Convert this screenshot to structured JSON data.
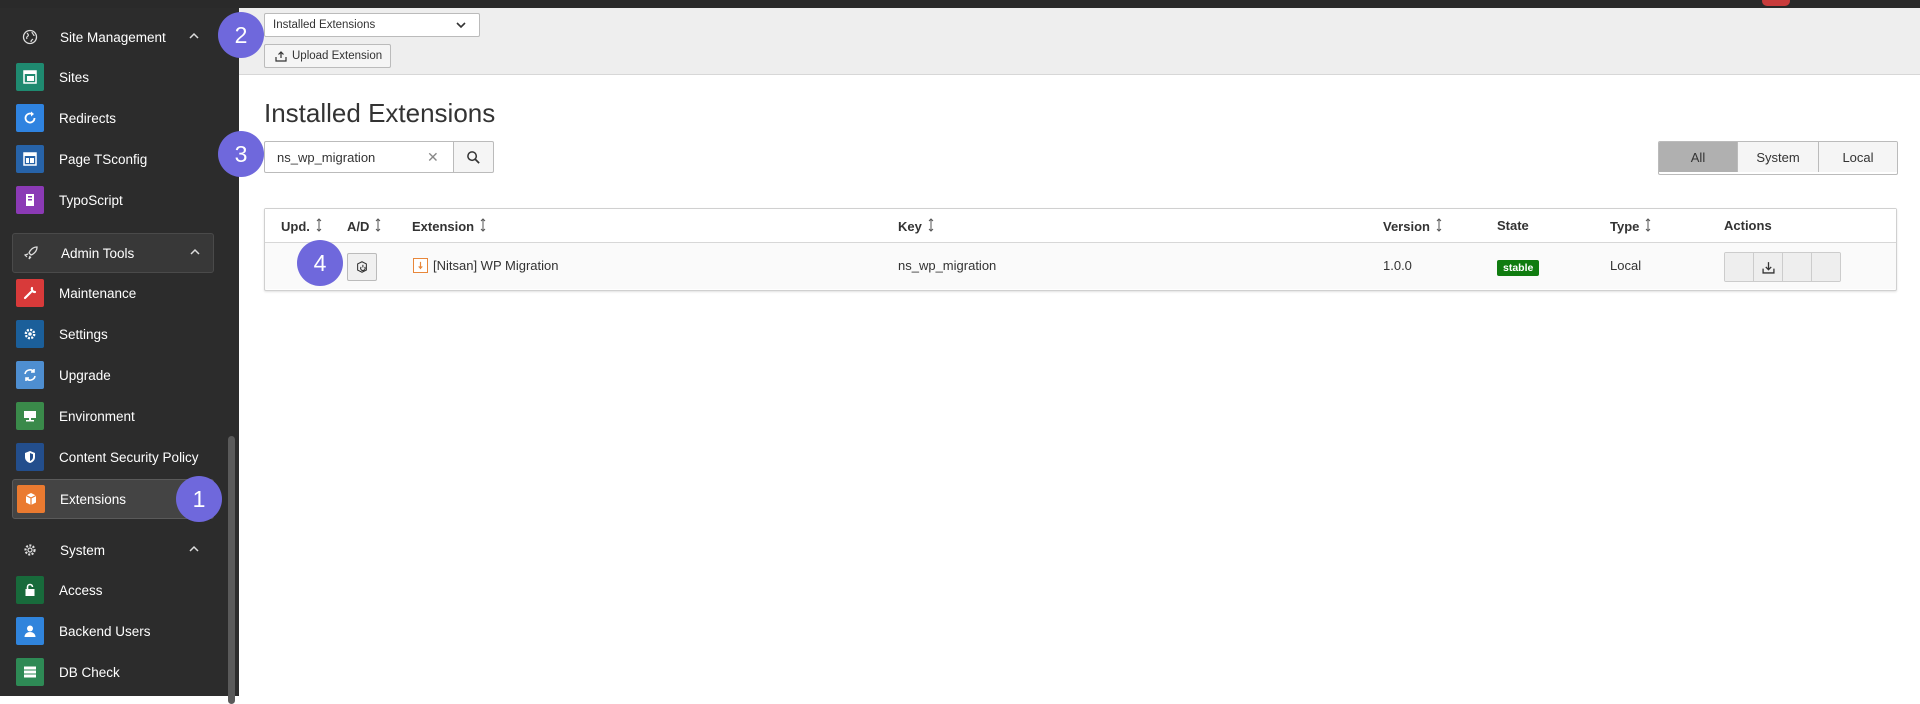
{
  "sidebar": {
    "groups": [
      {
        "label": "Site Management",
        "icon": "globe-icon"
      },
      {
        "label": "Admin Tools",
        "icon": "rocket-icon"
      },
      {
        "label": "System",
        "icon": "gear-icon"
      }
    ],
    "items": [
      {
        "label": "Sites",
        "color": "#1f8a70",
        "icon": "sites-icon"
      },
      {
        "label": "Redirects",
        "color": "#2f83e0",
        "icon": "redirect-icon"
      },
      {
        "label": "Page TSconfig",
        "color": "#2763a8",
        "icon": "tsconfig-icon"
      },
      {
        "label": "TypoScript",
        "color": "#8b3ab5",
        "icon": "typoscript-icon"
      },
      {
        "label": "Maintenance",
        "color": "#d83a3a",
        "icon": "wrench-icon"
      },
      {
        "label": "Settings",
        "color": "#1b5f9a",
        "icon": "cog-icon"
      },
      {
        "label": "Upgrade",
        "color": "#4e8ed0",
        "icon": "refresh-icon"
      },
      {
        "label": "Environment",
        "color": "#3a8a4a",
        "icon": "monitor-icon"
      },
      {
        "label": "Content Security Policy",
        "color": "#234e8c",
        "icon": "shield-icon"
      },
      {
        "label": "Extensions",
        "color": "#ea7a30",
        "icon": "box-icon"
      },
      {
        "label": "Access",
        "color": "#186a3b",
        "icon": "lock-icon"
      },
      {
        "label": "Backend Users",
        "color": "#3084dc",
        "icon": "user-icon"
      },
      {
        "label": "DB Check",
        "color": "#2e8a55",
        "icon": "database-icon"
      }
    ]
  },
  "header": {
    "select_value": "Installed Extensions",
    "upload_label": "Upload Extension"
  },
  "main": {
    "title": "Installed Extensions",
    "search_value": "ns_wp_migration",
    "filters": [
      "All",
      "System",
      "Local"
    ],
    "active_filter": "All"
  },
  "table": {
    "columns": [
      "Upd.",
      "A/D",
      "Extension",
      "Key",
      "Version",
      "State",
      "Type",
      "Actions"
    ],
    "rows": [
      {
        "extension": "[Nitsan] WP Migration",
        "key": "ns_wp_migration",
        "version": "1.0.0",
        "state": "stable",
        "type": "Local"
      }
    ]
  },
  "markers": [
    "1",
    "2",
    "3",
    "4"
  ],
  "colors": {
    "marker": "#6f68dc",
    "stable": "#107c10"
  }
}
